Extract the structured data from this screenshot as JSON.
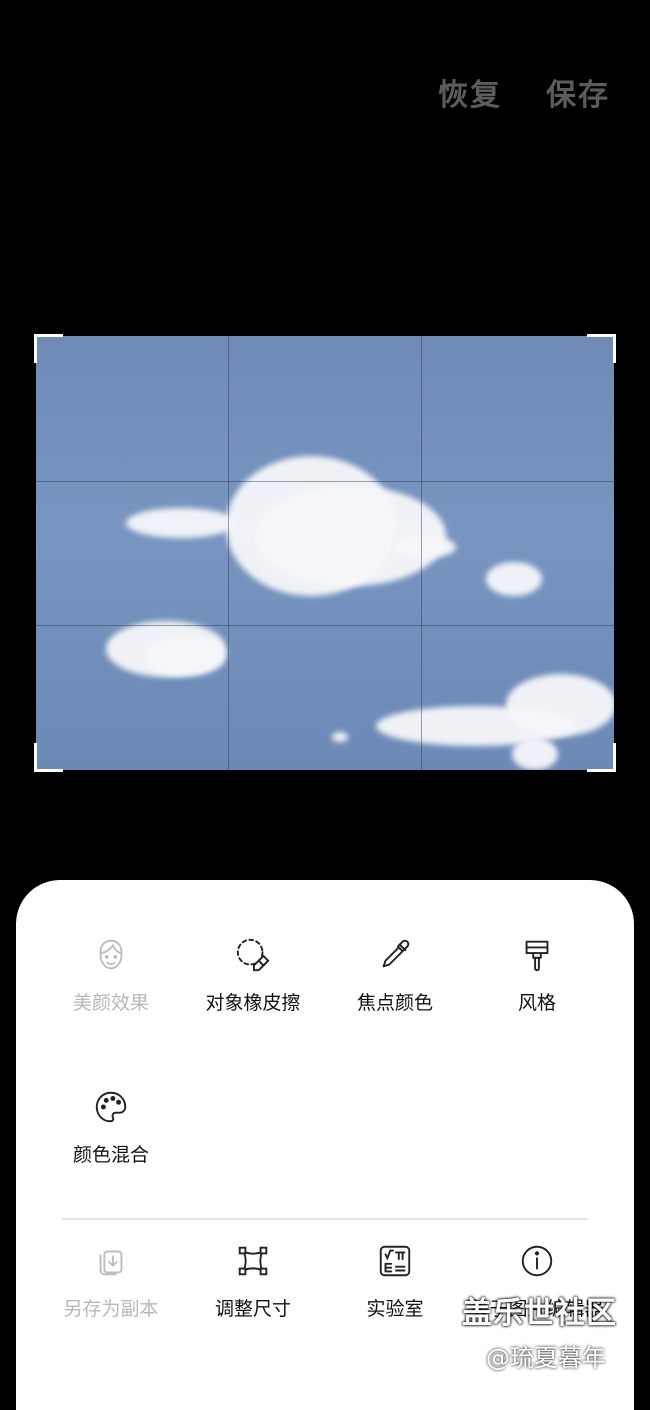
{
  "header": {
    "restore_label": "恢复",
    "save_label": "保存"
  },
  "tools": {
    "row1": [
      {
        "label": "美颜效果",
        "icon": "face-icon",
        "enabled": false
      },
      {
        "label": "对象橡皮擦",
        "icon": "object-eraser-icon",
        "enabled": true
      },
      {
        "label": "焦点颜色",
        "icon": "eyedropper-icon",
        "enabled": true
      },
      {
        "label": "风格",
        "icon": "brush-icon",
        "enabled": true
      }
    ],
    "row2": [
      {
        "label": "颜色混合",
        "icon": "palette-icon",
        "enabled": true
      }
    ],
    "bottom": [
      {
        "label": "另存为副本",
        "icon": "save-copy-icon",
        "enabled": false
      },
      {
        "label": "调整尺寸",
        "icon": "resize-icon",
        "enabled": true
      },
      {
        "label": "实验室",
        "icon": "lab-icon",
        "enabled": true
      },
      {
        "label": "关于图片编辑器",
        "icon": "info-icon",
        "enabled": true
      }
    ]
  },
  "watermark": {
    "brand": "盖乐世社区",
    "user": "@琉夏暮年"
  },
  "colors": {
    "background": "#000000",
    "panel": "#ffffff",
    "sky": "#7592bd",
    "disabled_text": "#b8b8b8"
  }
}
